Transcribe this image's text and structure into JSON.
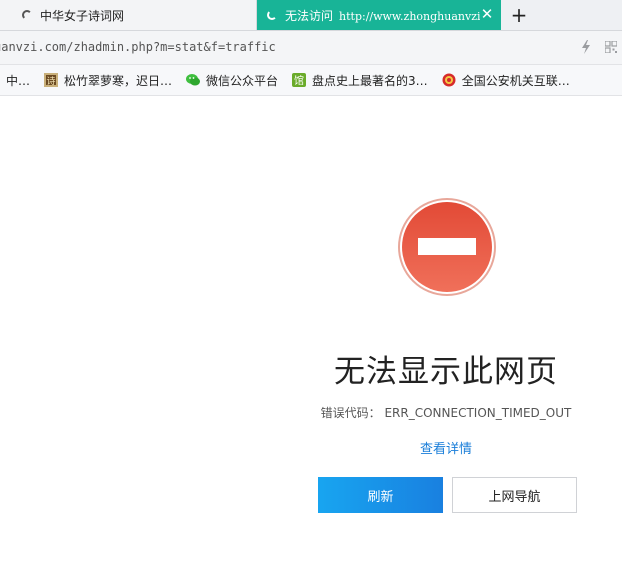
{
  "tabs": [
    {
      "title": "中华女子诗词网"
    },
    {
      "title": "无法访问",
      "url_suffix": "http://www.zhonghuanvzi"
    }
  ],
  "new_tab_icon": "plus-icon",
  "address_bar": {
    "url": "uanvzi.com/zhadmin.php?m=stat&f=traffic"
  },
  "bookmarks": [
    {
      "label": "中…",
      "icon": "none"
    },
    {
      "label": "松竹翠萝寒，迟日…",
      "icon": "poem-icon"
    },
    {
      "label": "微信公众平台",
      "icon": "wechat-icon"
    },
    {
      "label": "盘点史上最著名的3…",
      "icon": "green-box-icon"
    },
    {
      "label": "全国公安机关互联…",
      "icon": "police-badge-icon"
    }
  ],
  "error": {
    "title": "无法显示此网页",
    "code_label": "错误代码：",
    "code": "ERR_CONNECTION_TIMED_OUT",
    "details_link": "查看详情",
    "refresh_button": "刷新",
    "nav_button": "上网导航"
  },
  "colors": {
    "active_tab": "#18b497",
    "error_red": "#e4503a",
    "link_blue": "#1a7ed9",
    "button_blue": "#1890e8"
  }
}
